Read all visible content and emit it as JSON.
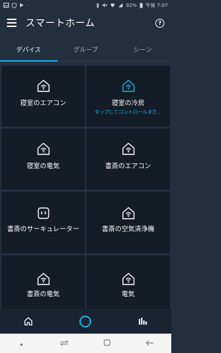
{
  "status_bar": {
    "left_icons": [
      "image-icon",
      "shield-icon",
      "play-icon",
      "dot-icon"
    ],
    "battery": "92%",
    "time": "午後 7:07"
  },
  "header": {
    "title": "スマートホーム",
    "help_symbol": "?"
  },
  "tabs": [
    {
      "label": "デバイス",
      "active": true
    },
    {
      "label": "グループ",
      "active": false
    },
    {
      "label": "シーン",
      "active": false
    }
  ],
  "devices": [
    {
      "name": "寝室のエアコン",
      "icon": "home-wifi-icon",
      "status": ""
    },
    {
      "name": "寝室の冷房",
      "icon": "home-wifi-icon",
      "status": "タップしてコントロールまた..."
    },
    {
      "name": "寝室の電気",
      "icon": "home-wifi-icon",
      "status": ""
    },
    {
      "name": "書斎のエアコン",
      "icon": "home-wifi-icon",
      "status": ""
    },
    {
      "name": "書斎のサーキュレーター",
      "icon": "plug-icon",
      "status": ""
    },
    {
      "name": "書斎の空気清浄機",
      "icon": "home-wifi-icon",
      "status": ""
    },
    {
      "name": "書斎の電気",
      "icon": "home-wifi-icon",
      "status": ""
    },
    {
      "name": "電気",
      "icon": "home-wifi-icon",
      "status": ""
    }
  ],
  "colors": {
    "background": "#232f3e",
    "card": "#141c26",
    "accent": "#1bb5e8"
  },
  "bottom_nav": [
    "home-icon",
    "alexa-icon",
    "devices-icon"
  ],
  "system_nav": [
    "dot-icon",
    "recents-icon",
    "home-square-icon",
    "back-icon"
  ]
}
